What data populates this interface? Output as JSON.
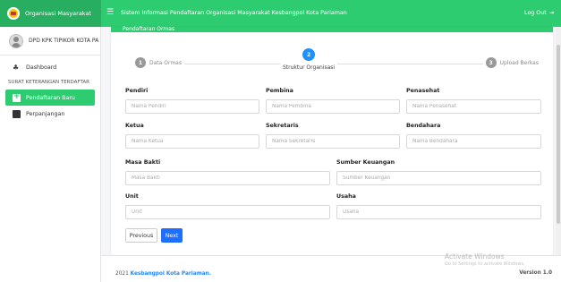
{
  "topbar": {
    "brand": "Organisasi Masyarakat",
    "app_title": "Sistem Informasi Pendaftaran Organisasi Masyarakat Kesbangpol Kota Pariaman",
    "logout_label": "Log Out",
    "logout_icon": "sign-out-icon",
    "accent_color": "#2ecc71"
  },
  "sidebar": {
    "user_name": "DPD KPK TIPIKOR KOTA PA",
    "items": [
      {
        "label": "Dashboard",
        "icon": "dashboard-icon"
      },
      {
        "label": "SURAT KETERANGAN TERDAFTAR",
        "type": "header"
      },
      {
        "label": "Pendaftaran Baru",
        "icon": "plus-square-icon",
        "active": true
      },
      {
        "label": "Perpanjangan",
        "icon": "book-icon"
      }
    ]
  },
  "card": {
    "header_text": "Pendaftaran Ormas"
  },
  "stepper": {
    "steps": [
      {
        "number": "1",
        "label": "Data Ormas"
      },
      {
        "number": "2",
        "label": "Struktur Organisasi",
        "active": true
      },
      {
        "number": "3",
        "label": "Upload Berkas"
      }
    ]
  },
  "form": {
    "pendiri": {
      "label": "Pendiri",
      "placeholder": "Nama Pendiri"
    },
    "pembina": {
      "label": "Pembina",
      "placeholder": "Nama Pembina"
    },
    "penasehat": {
      "label": "Penasehat",
      "placeholder": "Nama Penasehat"
    },
    "ketua": {
      "label": "Ketua",
      "placeholder": "Nama Ketua"
    },
    "sekretaris": {
      "label": "Sekretaris",
      "placeholder": "Nama Sekretaris"
    },
    "bendahara": {
      "label": "Bendahara",
      "placeholder": "Nama Bendahara"
    },
    "masa_bakti": {
      "label": "Masa Bakti",
      "placeholder": "Masa Bakti"
    },
    "sumber_keuangan": {
      "label": "Sumber Keuangan",
      "placeholder": "Sumber Keuangan"
    },
    "unit": {
      "label": "Unit",
      "placeholder": "Unit"
    },
    "usaha": {
      "label": "Usaha",
      "placeholder": "Usaha"
    }
  },
  "buttons": {
    "previous": "Previous",
    "next": "Next"
  },
  "watermark": {
    "line1": "Activate Windows",
    "line2": "Go to Settings to activate Windows."
  },
  "footer": {
    "year": "2021",
    "org": "Kesbangpol Kota Pariaman.",
    "version": "Version 1.0"
  }
}
